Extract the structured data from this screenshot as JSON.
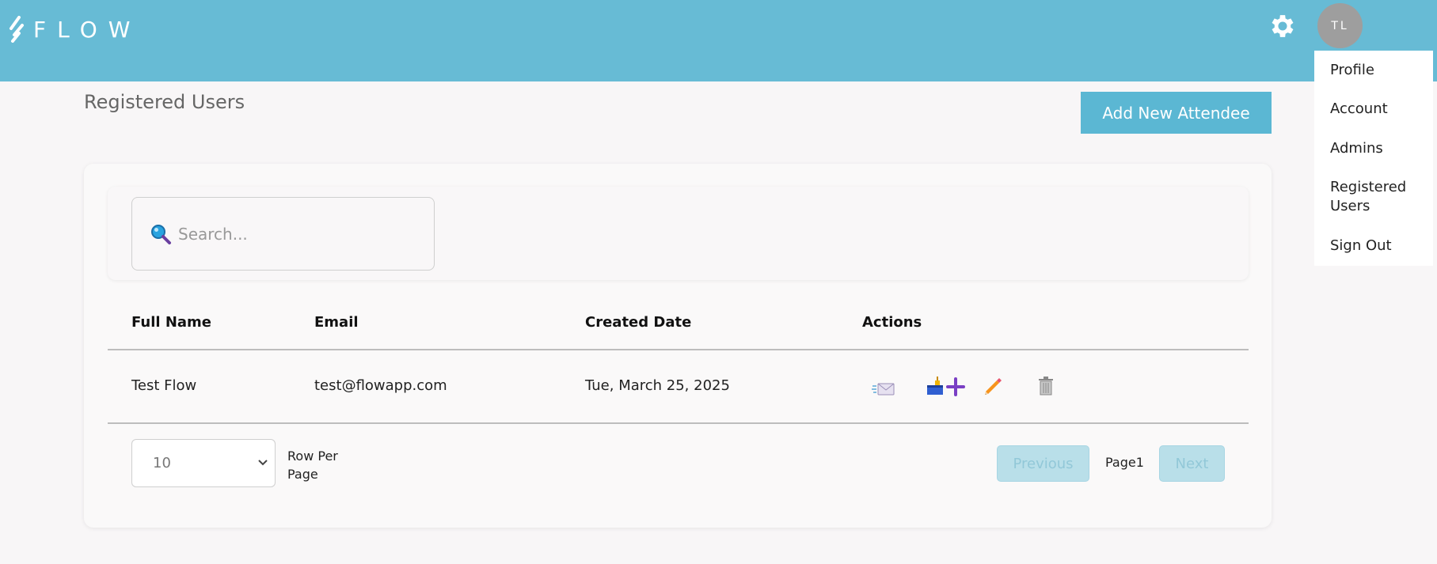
{
  "app": {
    "logo_text": "FLOW"
  },
  "header": {
    "avatar_initials": "TL"
  },
  "user_menu": {
    "items": [
      "Profile",
      "Account",
      "Admins",
      "Registered",
      "Users",
      "Sign Out"
    ]
  },
  "page": {
    "title": "Registered Users",
    "add_button": "Add New Attendee"
  },
  "search": {
    "placeholder": "Search..."
  },
  "table": {
    "headers": [
      "Full Name",
      "Email",
      "Created Date",
      "Actions"
    ],
    "rows": [
      {
        "name": "Test Flow",
        "email": "test@flowapp.com",
        "created": "Tue, March 25, 2025"
      }
    ],
    "actions": [
      "envelope-icon",
      "attendee-plus-icon",
      "pencil-icon",
      "trash-icon"
    ]
  },
  "pagination": {
    "rows_per_page_value": "10",
    "rows_per_page_label_1": "Row Per",
    "rows_per_page_label_2": "Page",
    "previous": "Previous",
    "page_label": "Page1",
    "next": "Next"
  },
  "colors": {
    "topbar": "#67bbd5",
    "accent_button": "#5bb7d3",
    "background": "#f8f6f7",
    "disabled_button": "#b9dfe9"
  }
}
